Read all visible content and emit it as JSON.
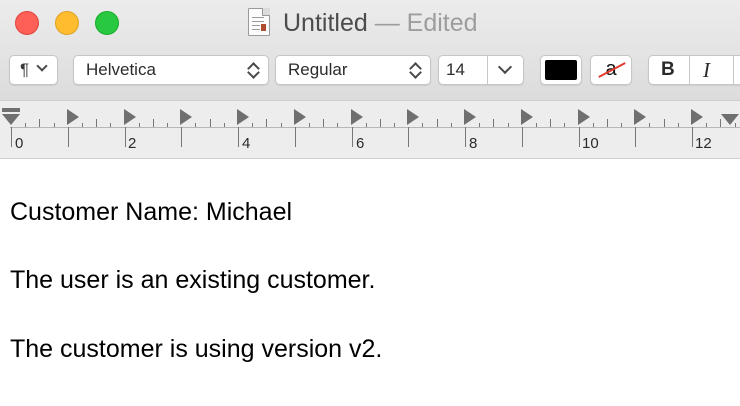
{
  "window": {
    "title": "Untitled",
    "title_separator": "—",
    "status": "Edited"
  },
  "toolbar": {
    "paragraph_menu_label": "¶",
    "font_family": "Helvetica",
    "font_style": "Regular",
    "font_size": "14",
    "text_color": "#000000",
    "background_color_glyph": "a",
    "bold_label": "B",
    "italic_label": "I"
  },
  "ruler": {
    "labels": [
      "0",
      "2",
      "4",
      "6",
      "8",
      "10",
      "12"
    ]
  },
  "document": {
    "lines": [
      "Customer Name: Michael",
      "The user is an existing customer.",
      "The customer is using version v2."
    ]
  }
}
